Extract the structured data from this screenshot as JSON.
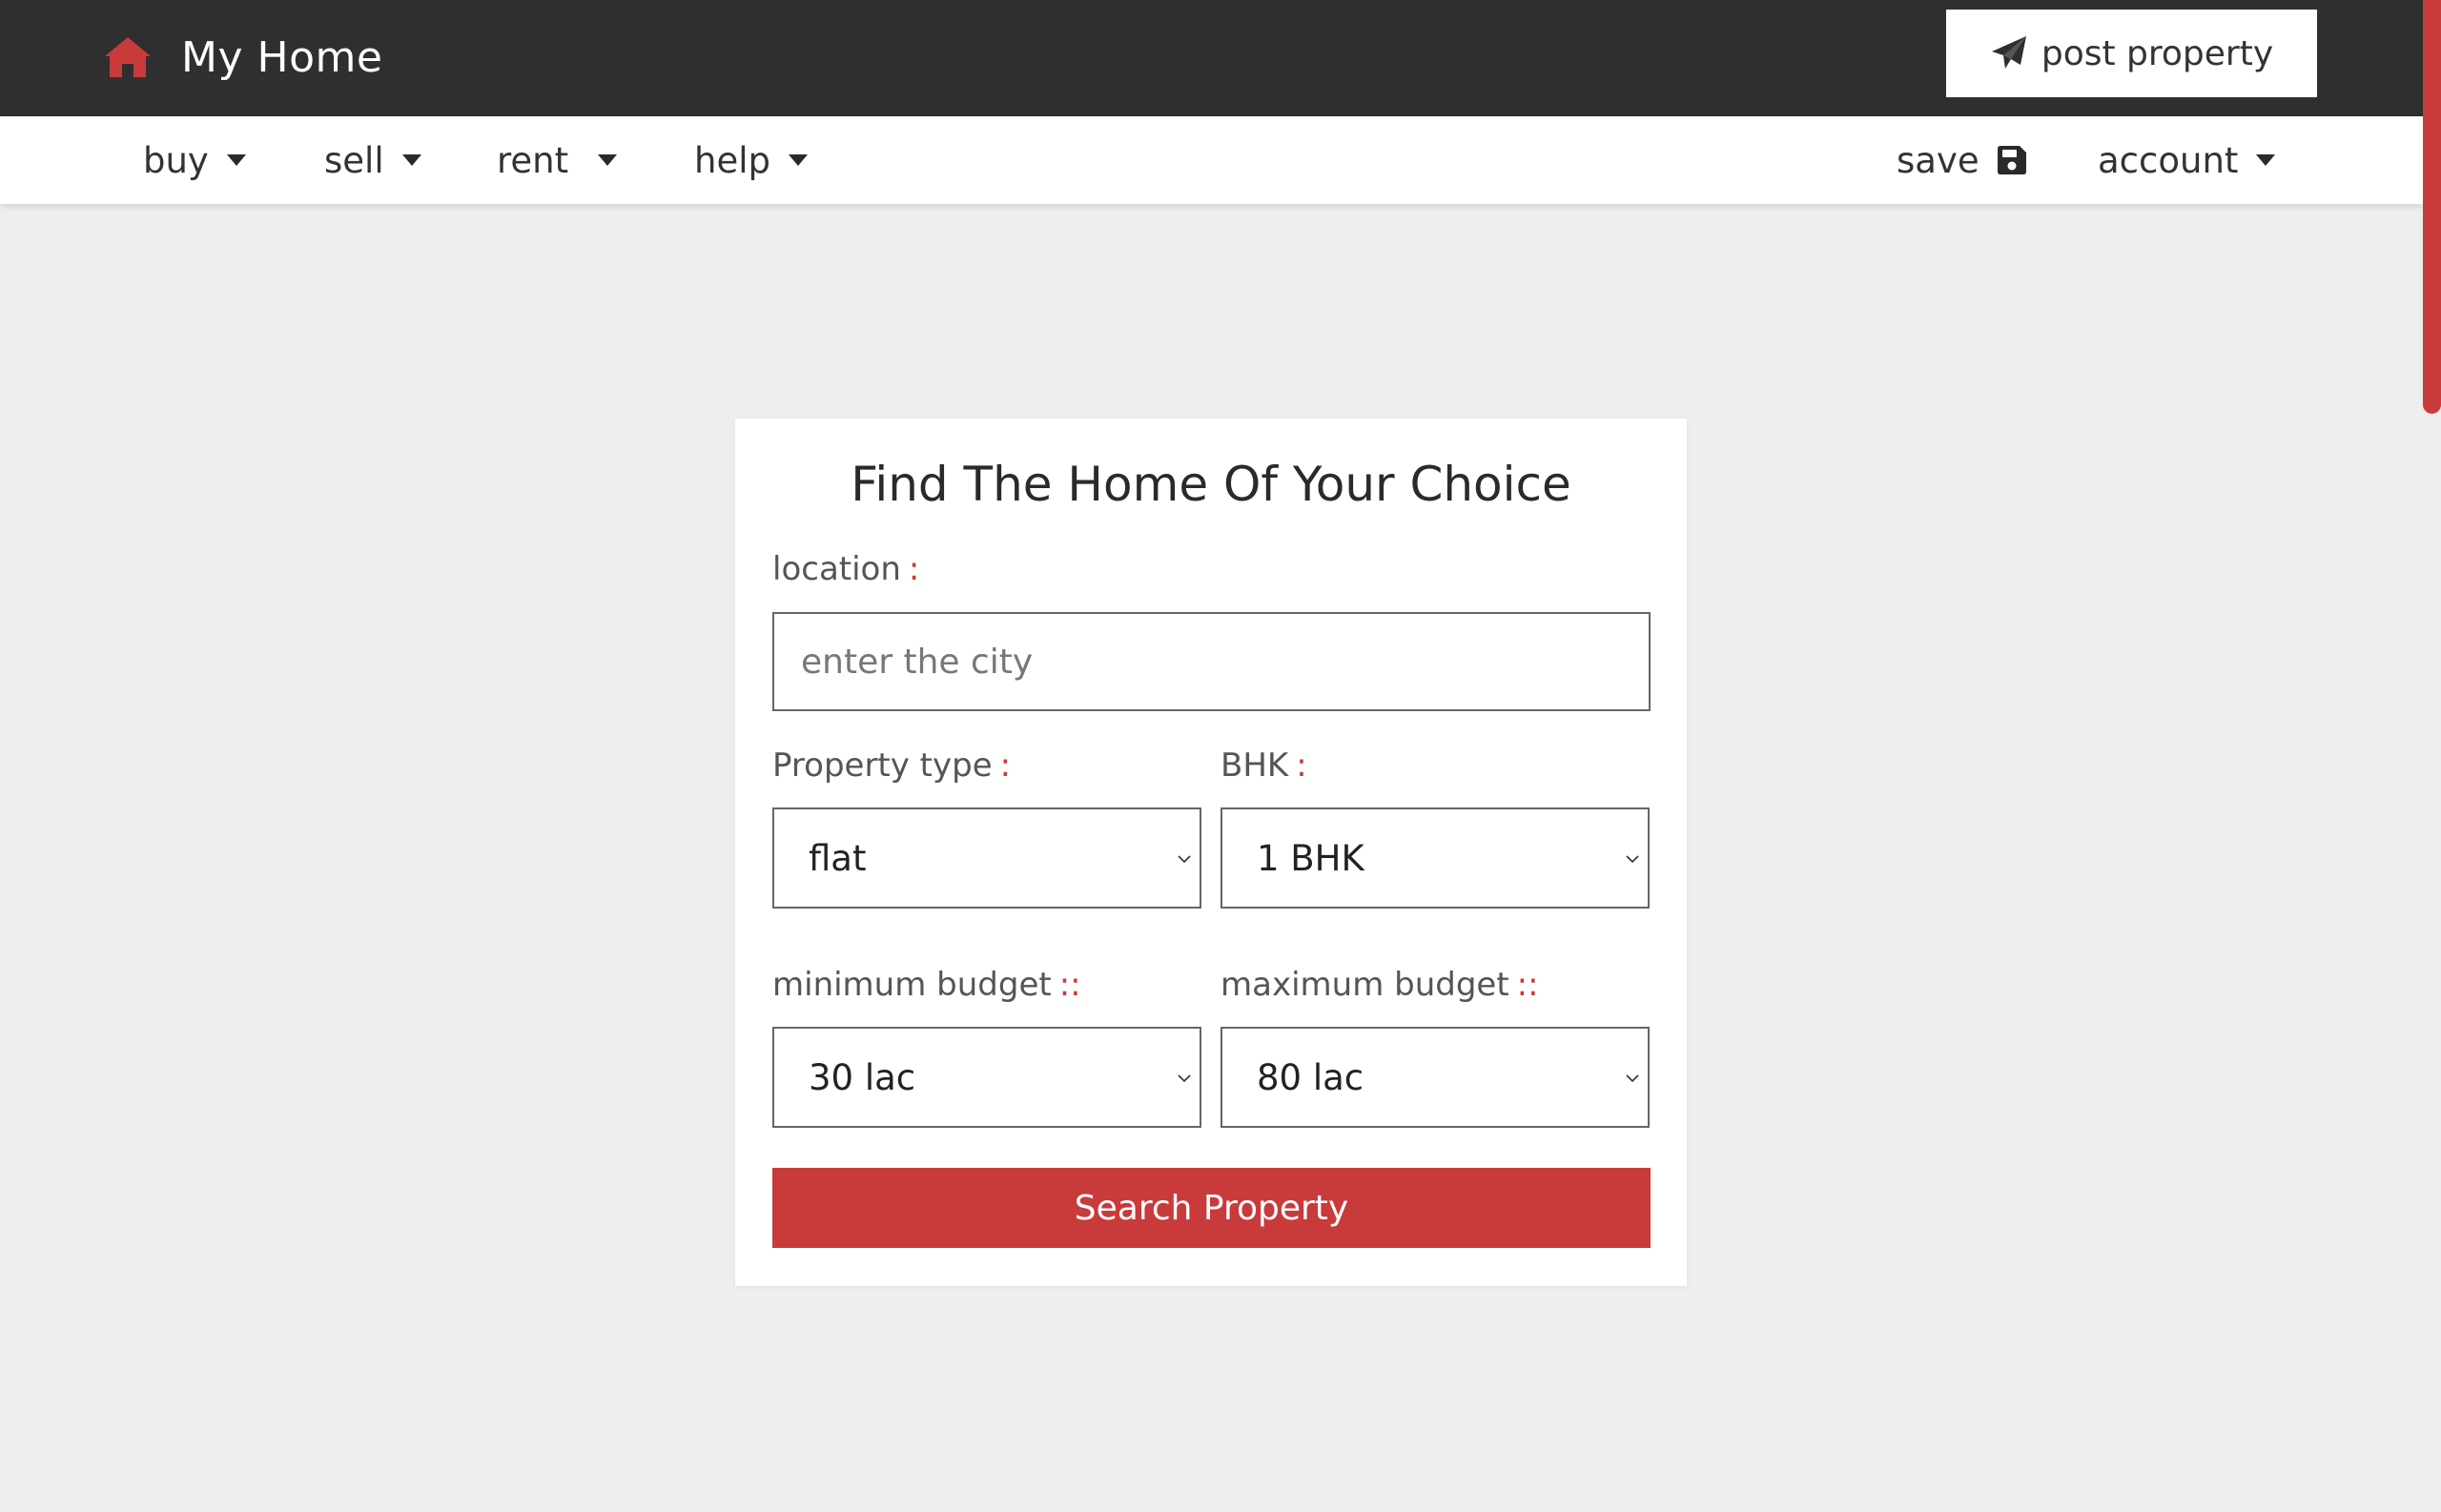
{
  "app": {
    "title": "My Home",
    "logo_icon": "home-icon",
    "brand_color": "#c93a3a",
    "header_bg": "#2f2f2f"
  },
  "header": {
    "post_label": "post property",
    "post_icon": "paper-plane-icon"
  },
  "nav": {
    "left": [
      {
        "label": "buy",
        "icon": "caret-down-icon"
      },
      {
        "label": "sell",
        "icon": "caret-down-icon"
      },
      {
        "label": "rent",
        "icon": "caret-down-icon"
      },
      {
        "label": "help",
        "icon": "caret-down-icon"
      }
    ],
    "save": {
      "label": "save",
      "icon": "floppy-disk-icon"
    },
    "account": {
      "label": "account",
      "icon": "caret-down-icon"
    }
  },
  "form": {
    "title": "Find The Home Of Your Choice",
    "location": {
      "label": "location",
      "sep": ":",
      "placeholder": "enter the city",
      "value": ""
    },
    "property_type": {
      "label": "Property type",
      "sep": ":",
      "selected": "flat"
    },
    "bhk": {
      "label": "BHK",
      "sep": ":",
      "selected": "1 BHK"
    },
    "min_budget": {
      "label": "minimum budget",
      "sep": "::",
      "selected": "30 lac"
    },
    "max_budget": {
      "label": "maximum budget",
      "sep": "::",
      "selected": "80 lac"
    },
    "submit_label": "Search Property"
  }
}
